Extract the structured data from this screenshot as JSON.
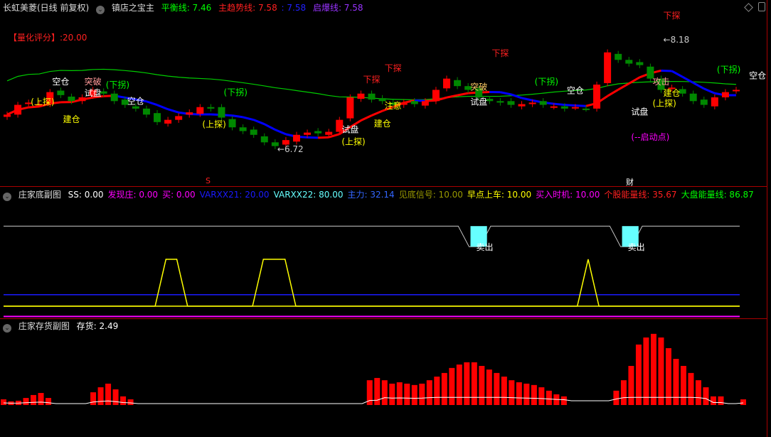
{
  "header": {
    "stock": "长虹美菱(日线 前复权)",
    "indicator": "镇店之宝主",
    "balance_label": "平衡线",
    "balance_value": ": 7.46",
    "trend_label": "主趋势线",
    "trend_value": ": 7.58",
    "blue_value": ": 7.58",
    "burst_label": "启爆线",
    "burst_value": ": 7.58",
    "score": "【量化评分】:20.00"
  },
  "panel1": {
    "title": "庄家底副图",
    "items": [
      {
        "t": "SS: 0.00",
        "c": "#ffffff"
      },
      {
        "t": "发现庄: 0.00",
        "c": "#ff00ff"
      },
      {
        "t": "买: 0.00",
        "c": "#ff00ff"
      },
      {
        "t": "VARXX21: 20.00",
        "c": "#1a1aff"
      },
      {
        "t": "VARXX22: 80.00",
        "c": "#66ffff"
      },
      {
        "t": "主力: 32.14",
        "c": "#3366ff"
      },
      {
        "t": "见底信号: 10.00",
        "c": "#999900"
      },
      {
        "t": "早点上车: 10.00",
        "c": "#ffff00"
      },
      {
        "t": "买入时机: 10.00",
        "c": "#ff00ff"
      },
      {
        "t": "个股能量线: 35.67",
        "c": "#ff2020"
      },
      {
        "t": "大盘能量线: 86.87",
        "c": "#00ff00"
      }
    ],
    "sell_label": "卖出"
  },
  "panel2": {
    "title": "庄家存货副图",
    "label": "存货: 2.49"
  },
  "markers": {
    "s": "S",
    "cai": "财"
  },
  "colors": {
    "up": "#ff0000",
    "down": "#008800",
    "balance": "#00cc00",
    "trend_up": "#ff0000",
    "trend_down": "#0000ff"
  },
  "chart_data": [
    {
      "type": "candlestick",
      "title": "镇店之宝主",
      "close": [
        7.22,
        7.35,
        7.38,
        7.36,
        7.52,
        7.48,
        7.4,
        7.45,
        7.55,
        7.5,
        7.4,
        7.35,
        7.3,
        7.22,
        7.12,
        7.15,
        7.2,
        7.25,
        7.32,
        7.3,
        7.18,
        7.05,
        7.0,
        6.95,
        6.85,
        6.8,
        6.88,
        6.95,
        6.98,
        6.97,
        6.99,
        7.15,
        7.45,
        7.5,
        7.42,
        7.4,
        7.35,
        7.38,
        7.36,
        7.4,
        7.55,
        7.7,
        7.6,
        7.55,
        7.45,
        7.4,
        7.38,
        7.35,
        7.36,
        7.38,
        7.35,
        7.33,
        7.3,
        7.32,
        7.3,
        7.62,
        8.05,
        7.95,
        7.9,
        7.88,
        7.7,
        7.55,
        7.58,
        7.5,
        7.4,
        7.35,
        7.45,
        7.52,
        7.55
      ],
      "ylim": [
        6.45,
        8.5
      ],
      "annotations": [
        {
          "t": "空仓",
          "i": 5,
          "p": 7.62,
          "c": "#ffffff"
        },
        {
          "t": "(上探)",
          "i": 3,
          "p": 7.35,
          "c": "#ffff00"
        },
        {
          "t": "建仓",
          "i": 6,
          "p": 7.12,
          "c": "#ffff00"
        },
        {
          "t": "试盘",
          "i": 8,
          "p": 7.47,
          "c": "#ffffff"
        },
        {
          "t": "突破",
          "i": 8,
          "p": 7.62,
          "c": "#ff9999"
        },
        {
          "t": "(下拐)",
          "i": 10,
          "p": 7.58,
          "c": "#00ff00"
        },
        {
          "t": "空仓",
          "i": 12,
          "p": 7.36,
          "c": "#ffffff"
        },
        {
          "t": "(下拐)",
          "i": 21,
          "p": 7.48,
          "c": "#00ff00"
        },
        {
          "t": "(上探)",
          "i": 19,
          "p": 7.05,
          "c": "#ffff00"
        },
        {
          "t": "←6.72",
          "i": 26,
          "p": 6.72,
          "c": "#cccccc"
        },
        {
          "t": "(上探)",
          "i": 32,
          "p": 6.82,
          "c": "#ffff00"
        },
        {
          "t": "试盘",
          "i": 32,
          "p": 6.98,
          "c": "#ffffff"
        },
        {
          "t": "下探",
          "i": 34,
          "p": 7.65,
          "c": "#ff2020"
        },
        {
          "t": "建仓",
          "i": 35,
          "p": 7.06,
          "c": "#ffff00"
        },
        {
          "t": "注意",
          "i": 36,
          "p": 7.3,
          "c": "#ffff00"
        },
        {
          "t": "下探",
          "i": 36,
          "p": 7.8,
          "c": "#ff2020"
        },
        {
          "t": "突破",
          "i": 44,
          "p": 7.55,
          "c": "#ffcc66"
        },
        {
          "t": "试盘",
          "i": 44,
          "p": 7.35,
          "c": "#ffffff"
        },
        {
          "t": "下探",
          "i": 46,
          "p": 8.0,
          "c": "#ff2020"
        },
        {
          "t": "(下拐)",
          "i": 50,
          "p": 7.62,
          "c": "#00ff00"
        },
        {
          "t": "空仓",
          "i": 53,
          "p": 7.5,
          "c": "#ffffff"
        },
        {
          "t": "试盘",
          "i": 59,
          "p": 7.22,
          "c": "#ffffff"
        },
        {
          "t": "(上探)",
          "i": 61,
          "p": 7.33,
          "c": "#ffff00"
        },
        {
          "t": "(--启动点)",
          "i": 59,
          "p": 6.88,
          "c": "#ff00ff"
        },
        {
          "t": "攻击",
          "i": 61,
          "p": 7.62,
          "c": "#ff9999"
        },
        {
          "t": "建仓",
          "i": 62,
          "p": 7.47,
          "c": "#ffff00"
        },
        {
          "t": "下探",
          "i": 62,
          "p": 8.5,
          "c": "#ff2020"
        },
        {
          "t": "←8.18",
          "i": 62,
          "p": 8.18,
          "c": "#cccccc"
        },
        {
          "t": "(下拐)",
          "i": 67,
          "p": 7.78,
          "c": "#00ff00"
        },
        {
          "t": "空仓",
          "i": 70,
          "p": 7.7,
          "c": "#ffffff"
        }
      ]
    },
    {
      "type": "line",
      "title": "庄家底副图",
      "ylim": [
        0,
        100
      ],
      "series": [
        {
          "name": "VARXX22",
          "color": "#ffffff",
          "values": [
            80,
            80,
            80,
            80,
            80,
            80,
            80,
            80,
            80,
            80,
            80,
            80,
            80,
            80,
            80,
            80,
            80,
            80,
            80,
            80,
            80,
            80,
            80,
            80,
            80,
            80,
            80,
            80,
            80,
            80,
            80,
            80,
            80,
            80,
            80,
            80,
            80,
            80,
            80,
            80,
            80,
            80,
            80,
            62,
            62,
            80,
            80,
            80,
            80,
            80,
            80,
            80,
            80,
            80,
            80,
            80,
            80,
            62,
            62,
            80,
            80,
            80,
            80,
            80,
            80,
            80,
            80,
            80,
            80
          ]
        },
        {
          "name": "早点上车",
          "color": "#ffff00",
          "values": [
            10,
            10,
            10,
            10,
            10,
            10,
            10,
            10,
            10,
            10,
            10,
            10,
            10,
            10,
            10,
            51,
            51,
            10,
            10,
            10,
            10,
            10,
            10,
            10,
            51,
            51,
            51,
            10,
            10,
            10,
            10,
            10,
            10,
            10,
            10,
            10,
            10,
            10,
            10,
            10,
            10,
            10,
            10,
            10,
            10,
            10,
            10,
            10,
            10,
            10,
            10,
            10,
            10,
            10,
            51,
            10,
            10,
            10,
            10,
            10,
            10,
            10,
            10,
            10,
            10,
            10,
            10,
            10,
            10
          ]
        },
        {
          "name": "VARXX21",
          "color": "#1a1aff",
          "values": [
            20
          ]
        },
        {
          "name": "买",
          "color": "#ff00ff",
          "values": [
            1
          ]
        }
      ]
    },
    {
      "type": "bar",
      "title": "庄家存货副图",
      "values": [
        2.5,
        1.6,
        1.9,
        3.1,
        4.4,
        5.3,
        3.1,
        0,
        0,
        0,
        0,
        0,
        5.6,
        7.8,
        9.4,
        6.9,
        3.8,
        2.5,
        0,
        0,
        0,
        0,
        0,
        0,
        0,
        0,
        0,
        0,
        0,
        0,
        0,
        0,
        0,
        0,
        0,
        0,
        0,
        0,
        0,
        0,
        0,
        0,
        0,
        0,
        0,
        0,
        0,
        0,
        0,
        10.9,
        11.9,
        10.9,
        9.4,
        10,
        9.4,
        8.8,
        9.4,
        10.9,
        12.5,
        14.1,
        16.3,
        17.8,
        18.8,
        18.8,
        17.2,
        15.6,
        14.1,
        12.5,
        10.9,
        10,
        9.4,
        8.8,
        7.8,
        6.3,
        4.7,
        3.8,
        0,
        0,
        0,
        0,
        0,
        0,
        6.3,
        10.9,
        17.2,
        26.6,
        29.7,
        31.3,
        29.7,
        25,
        20.3,
        17.2,
        14.1,
        10.9,
        7.8,
        3.8,
        3.8,
        0,
        0,
        2.49
      ]
    }
  ]
}
